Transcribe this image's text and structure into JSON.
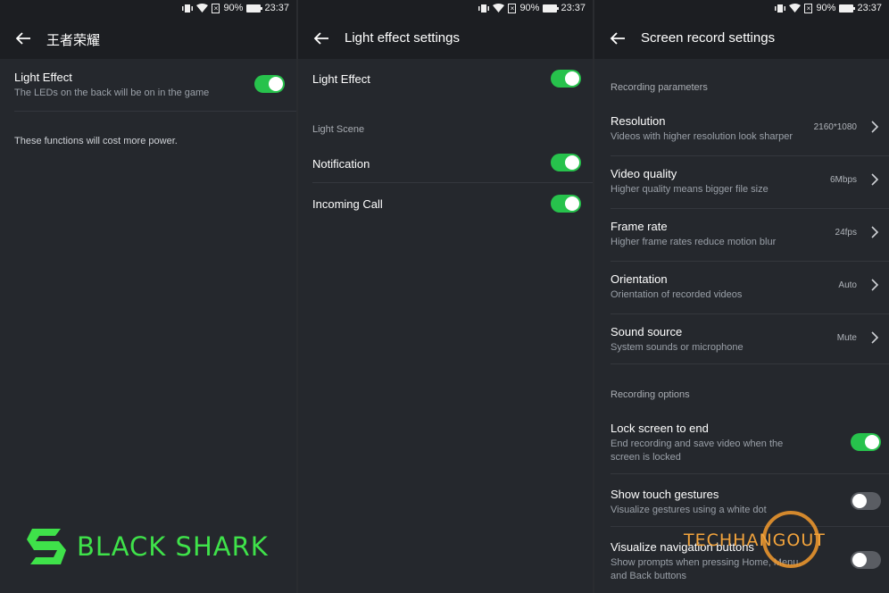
{
  "colors": {
    "accent": "#27c24c",
    "brand": "#3fe24a",
    "watermark": "#f3a43c",
    "background": "#25282d"
  },
  "status": {
    "battery": "90%",
    "time": "23:37"
  },
  "panel1": {
    "title": "王者荣耀",
    "light_effect_title": "Light Effect",
    "light_effect_sub": "The LEDs on the back will be on in the game",
    "light_effect_on": true,
    "note": "These functions will cost more power."
  },
  "panel2": {
    "title": "Light effect settings",
    "light_effect": "Light Effect",
    "section": "Light Scene",
    "notification": "Notification",
    "incoming_call": "Incoming Call"
  },
  "panel3": {
    "title": "Screen record settings",
    "section_params": "Recording parameters",
    "params": [
      {
        "title": "Resolution",
        "sub": "Videos with higher resolution look sharper",
        "value": "2160*1080"
      },
      {
        "title": "Video quality",
        "sub": "Higher quality means bigger file size",
        "value": "6Mbps"
      },
      {
        "title": "Frame rate",
        "sub": "Higher frame rates reduce motion blur",
        "value": "24fps"
      },
      {
        "title": "Orientation",
        "sub": "Orientation of recorded videos",
        "value": "Auto"
      },
      {
        "title": "Sound source",
        "sub": "System sounds or microphone",
        "value": "Mute"
      }
    ],
    "section_options": "Recording options",
    "options": [
      {
        "title": "Lock screen to end",
        "sub": "End recording and save video when the screen is locked",
        "on": true
      },
      {
        "title": "Show touch gestures",
        "sub": "Visualize gestures using a white dot",
        "on": false
      },
      {
        "title": "Visualize navigation buttons",
        "sub": "Show prompts when pressing Home, Menu, and Back buttons",
        "on": false
      }
    ]
  },
  "brand": {
    "text": "BLACK SHARK"
  },
  "watermark": {
    "text": "TECHHANGOUT"
  }
}
